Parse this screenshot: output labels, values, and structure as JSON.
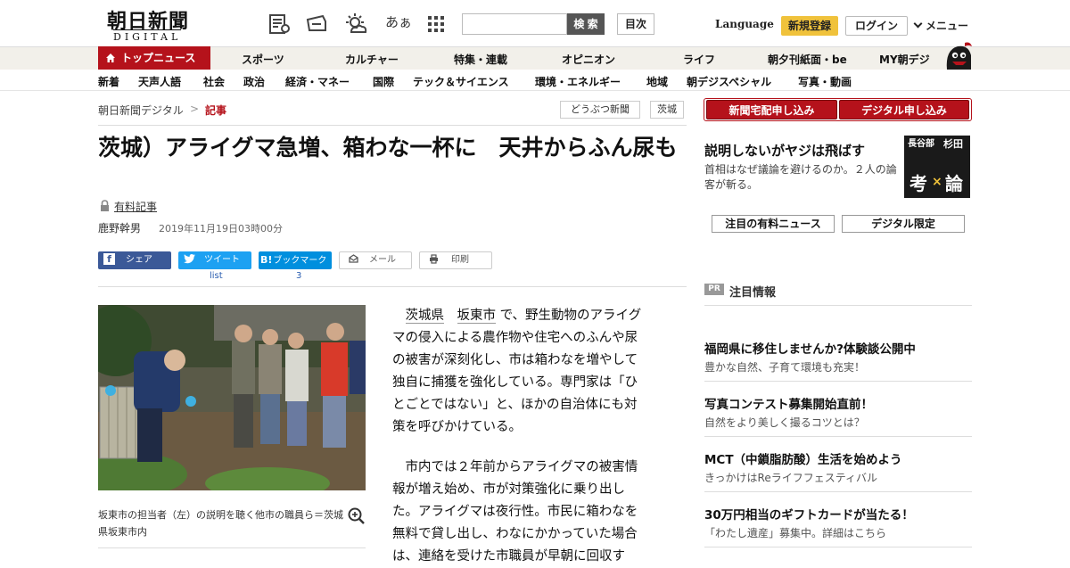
{
  "header": {
    "logo_jp": "朝日新聞",
    "logo_en": "DIGITAL",
    "search_button": "検 索",
    "toc_button": "目次",
    "language": "Language",
    "register": "新規登録",
    "login": "ログイン",
    "menu": "メニュー",
    "font_size_glyph": "あぁ"
  },
  "nav_main": {
    "top_news": "トップニュース",
    "items": [
      "スポーツ",
      "カルチャー",
      "特集・連載",
      "オピニオン",
      "ライフ",
      "朝夕刊紙面・be",
      "MY朝デジ"
    ]
  },
  "nav_sub": {
    "items": [
      "新着",
      "天声人語",
      "社会",
      "政治",
      "経済・マネー",
      "国際",
      "テック＆サイエンス",
      "環境・エネルギー",
      "地域",
      "朝デジスペシャル",
      "写真・動画"
    ]
  },
  "breadcrumb": {
    "home": "朝日新聞デジタル",
    "sep": ">",
    "current": "記事"
  },
  "tags": [
    "どうぶつ新聞",
    "茨城"
  ],
  "subscribe": {
    "paper": "新聞宅配申し込み",
    "digital": "デジタル申し込み"
  },
  "article": {
    "title": "茨城）アライグマ急増、箱わな一杯に　天井からふん尿も",
    "paid_label": "有料記事",
    "author": "鹿野幹男",
    "date": "2019年11月19日03時00分",
    "share": {
      "facebook": "シェア",
      "twitter": "ツイート",
      "hatena": "ブックマーク",
      "hatena_logo": "B!",
      "mail": "メール",
      "print": "印刷",
      "twitter_count": "list",
      "hatena_count": "3"
    },
    "photo_caption": "坂東市の担当者（左）の説明を聴く他市の職員ら＝茨城県坂東市内",
    "para1_link1": "茨城県",
    "para1_link2": "坂東市",
    "para1_rest_lines": [
      "で、野生動物のアライグ",
      "マの侵入による農作物や住宅へのふんや尿",
      "の被害が深刻化し、市は箱わなを増やして",
      "独自に捕獲を強化している。専門家は「ひ",
      "とごとではない」と、ほかの自治体にも対",
      "策を呼びかけている。"
    ],
    "para2_lines": [
      "　市内では２年前からアライグマの被害情",
      "報が増え始め、市が対策強化に乗り出し",
      "た。アライグマは夜行性。市民に箱わなを",
      "無料で貸し出し、わなにかかっていた場合",
      "は、連絡を受けた市職員が早朝に回収す"
    ]
  },
  "sidebar": {
    "feature_title": "説明しないがヤジは飛ばす",
    "feature_sub": "首相はなぜ議論を避けるのか。２人の論客が斬る。",
    "badge_text": [
      "長谷部",
      "杉田",
      "考",
      "論"
    ],
    "pick1": "注目の有料ニュース",
    "pick2": "デジタル限定",
    "pr_badge": "PR",
    "pr_label": "注目情報",
    "ads": [
      {
        "title": "福岡県に移住しませんか?体験談公開中",
        "sub": "豊かな自然、子育て環境も充実！"
      },
      {
        "title": "写真コンテスト募集開始直前！",
        "sub": "自然をより美しく撮るコツとは？"
      },
      {
        "title": "MCT（中鎖脂肪酸）生活を始めよう",
        "sub": "きっかけはReライフフェスティバル"
      },
      {
        "title": "30万円相当のギフトカードが当たる！",
        "sub": "「わたし遺産」募集中。詳細はこちら"
      }
    ]
  },
  "colors": {
    "brand_red": "#b5121b",
    "register_yellow": "#f0c23b",
    "facebook": "#3b5998",
    "twitter": "#1da1f2",
    "hatena": "#008fde"
  }
}
